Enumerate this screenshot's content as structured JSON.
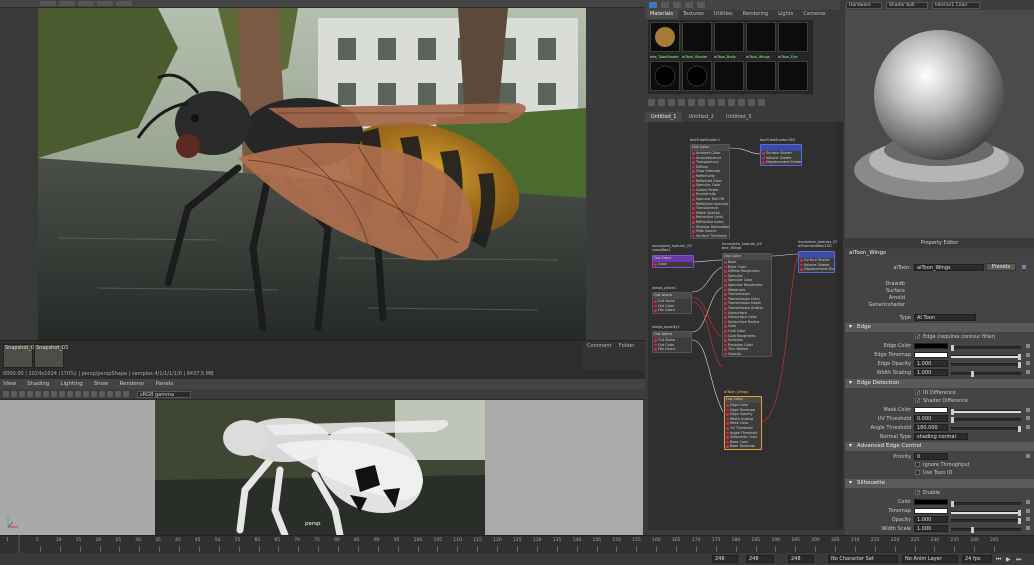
{
  "viewport_menu": {
    "items": [
      "View",
      "Shading",
      "Lighting",
      "Show",
      "Renderer",
      "Panels"
    ]
  },
  "viewport_toolbar": {
    "colorspace": "sRGB gamma"
  },
  "viewport": {
    "camera_label": "persp"
  },
  "render_view": {
    "snapshots": [
      {
        "label": "Snapshot_02"
      },
      {
        "label": "Snapshot_03"
      }
    ],
    "status": "0000.00 | 1024x1024 (170%) | persp/perspShape | samples 4/1/1/1/1/0 | 8437.5 MB",
    "comment_tabs": [
      "Comment",
      "Folder"
    ]
  },
  "hypershade": {
    "top_tabs": [
      "Materials",
      "Textures",
      "Utilities",
      "Rendering",
      "Lights",
      "Cameras"
    ],
    "materials": [
      {
        "label": "bee_TubeShader"
      },
      {
        "label": "aiToon_Shader"
      },
      {
        "label": "aiToon_Body"
      },
      {
        "label": "aiToon_Wings"
      },
      {
        "label": "aiToon_Eye"
      },
      {
        "label": "standardSurface1"
      }
    ],
    "graph_tabs": [
      "Untitled_1",
      "Untitled_2",
      "Untitled_3"
    ],
    "nodes": [
      {
        "title": "beeTubeShader1",
        "head": "Out Color",
        "ports": [
          "Ambient Color",
          "Incandescence",
          "Transparency",
          "Diffuse",
          "Glow Intensity",
          "Reflectivity",
          "Reflected Color",
          "Specular Color",
          "Cosine Power",
          "Eccentricity",
          "Specular Roll Off",
          "Reflection Specularity",
          "Translucence",
          "Matte Opacity",
          "Refraction Limit",
          "Refractive Index",
          "Shadow Attenuation",
          "Hide Source",
          "Surface Thickness"
        ]
      },
      {
        "title": "beeTubeShader1SG",
        "head": "",
        "ports": [
          "Surface Shader",
          "Volume Shader",
          "Displacement Shader"
        ]
      },
      {
        "title": "honeybee_hodular_03 rampBee1",
        "head": "Out Color",
        "ports": [
          "Color"
        ]
      },
      {
        "title": "honeybee_hodular_03 bee_Wings",
        "head": "Out Color",
        "ports": [
          "Base",
          "Base Color",
          "Diffuse Roughness",
          "Specular",
          "Specular Color",
          "Specular Roughness",
          "Metalness",
          "Transmission",
          "Transmission Color",
          "Transmission Depth",
          "Transmission Scatter",
          "Subsurface",
          "Subsurface Color",
          "Subsurface Radius",
          "Coat",
          "Coat Color",
          "Coat Roughness",
          "Emission",
          "Emission Color",
          "Thin Walled",
          "Opacity"
        ]
      },
      {
        "title": "honeybee_hodular_03 aiStandardBee1SG",
        "head": "",
        "ports": [
          "Surface Shader",
          "Volume Shader",
          "Displacement Shader"
        ]
      },
      {
        "title": "wings_place1",
        "head": "Out Alpha",
        "ports": [
          "Out Alpha",
          "Out Color",
          "File Coord"
        ]
      },
      {
        "title": "wings_opacity1",
        "head": "Out Alpha",
        "ports": [
          "Out Alpha",
          "Out Color",
          "File Coord"
        ]
      },
      {
        "title": "aiToon_Wings",
        "head": "Out Color",
        "ports": [
          "Edge Color",
          "Edge Tonemap",
          "Edge Opacity",
          "Width Scaling",
          "Mask Color",
          "UV Threshold",
          "Angle Threshold",
          "Silhouette Color",
          "Base Color",
          "Base Tonemap"
        ]
      }
    ]
  },
  "right_panel": {
    "header": {
      "mode": "Hardware",
      "shader_ball": "Shader ball",
      "light": "Interior1 Color"
    },
    "title_bar": "Property Editor",
    "tab": "aiToon_Wings",
    "name_label": "aiToon:",
    "name_value": "aiToon_Wings",
    "presets_label": "Presets",
    "classification": [
      "Drawdb",
      "Surface",
      "Arnold",
      "Genericshader"
    ],
    "type_label": "Type",
    "type_value": "AI Toon",
    "sections": {
      "edge": {
        "title": "Edge",
        "edge_checkbox": "Edge (requires contour filter)",
        "rows": [
          {
            "label": "Edge Color",
            "value": ""
          },
          {
            "label": "Edge Tonemap",
            "value": ""
          },
          {
            "label": "Edge Opacity",
            "value": "1.000"
          },
          {
            "label": "Width Scaling",
            "value": "1.000"
          }
        ]
      },
      "edge_detection": {
        "title": "Edge Detection",
        "checks": [
          "ID Difference",
          "Shader Difference"
        ],
        "rows": [
          {
            "label": "Mask Color",
            "value": ""
          },
          {
            "label": "UV Threshold",
            "value": "0.000"
          },
          {
            "label": "Angle Threshold",
            "value": "180.000"
          },
          {
            "label": "Normal Type",
            "value": "shading normal"
          }
        ]
      },
      "advanced": {
        "title": "Advanced Edge Control",
        "priority_label": "Priority",
        "priority_value": "0",
        "checks": [
          "Ignore Throughput",
          "Use Toon ID"
        ]
      },
      "silhouette": {
        "title": "Silhouette",
        "enable": "Enable",
        "rows": [
          {
            "label": "Color",
            "value": ""
          },
          {
            "label": "Tonemap",
            "value": ""
          },
          {
            "label": "Opacity",
            "value": "1.000"
          },
          {
            "label": "Width Scale",
            "value": "1.000"
          }
        ]
      }
    }
  },
  "timeline": {
    "ticks": [
      "5",
      "10",
      "15",
      "20",
      "25",
      "30",
      "35",
      "40",
      "45",
      "50",
      "55",
      "60",
      "65",
      "70",
      "75",
      "80",
      "85",
      "90",
      "95",
      "100",
      "105",
      "110",
      "115",
      "120",
      "125",
      "130",
      "135",
      "140",
      "145",
      "150",
      "155",
      "160",
      "165",
      "170",
      "175",
      "180",
      "185",
      "190",
      "195",
      "200",
      "205",
      "210",
      "215",
      "220",
      "225",
      "230",
      "235",
      "240",
      "245"
    ],
    "current_frame": "1"
  },
  "range_bar": {
    "start": "248",
    "end": "248",
    "end2": "248",
    "character_set": "No Character Set",
    "anim_layer": "No Anim Layer",
    "fps": "24 fps"
  }
}
